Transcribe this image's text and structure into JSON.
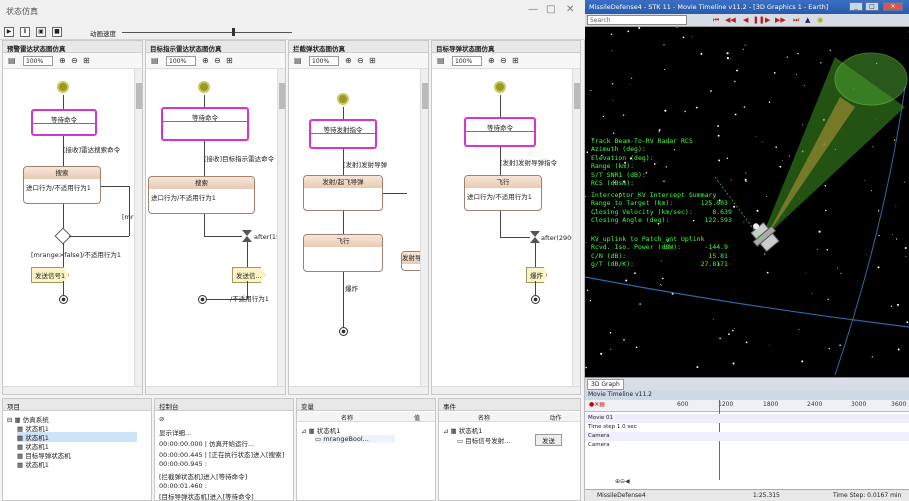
{
  "left_window": {
    "title": "状态仿真",
    "toolbar": {
      "step_label": "动画速度"
    },
    "panes": [
      {
        "title": "预警雷达状态图仿真",
        "zoom": "100%",
        "start_state": "等待命令",
        "trigger1": "[接收]雷达搜索命令",
        "state": {
          "name": "搜索",
          "body": "进口行为/不适用行为1"
        },
        "guard_label": "[mrange>false]/不适用行为1",
        "side_label": "[mrang",
        "send_label": "发送信号1"
      },
      {
        "title": "目标指示雷达状态图仿真",
        "zoom": "100%",
        "start_state": "等待命令",
        "trigger1": "[接收]目标指示雷达命令",
        "state": {
          "name": "搜索",
          "body": "进口行为/不适用行为1"
        },
        "after_label": "after(1500(",
        "send_label": "发送信...",
        "end_label": "/不适用行为1"
      },
      {
        "title": "拦截弹状态图仿真",
        "zoom": "100%",
        "start_state": "等待发射指令",
        "trigger1": "[发射]发射导弹",
        "state": {
          "name": "发射/起飞导弹"
        },
        "side_state": "发射导弹",
        "fly_state": "飞行",
        "end_label": "爆炸"
      },
      {
        "title": "目标导弹状态图仿真",
        "zoom": "100%",
        "start_state": "等待命令",
        "trigger1": "[发射]发射导弹指令",
        "state": {
          "name": "飞行",
          "body": "进口行为/不适用行为1"
        },
        "after_label": "after(2900(",
        "send_label": "爆炸"
      }
    ],
    "bottom": {
      "tree_title": "项目",
      "tree_items": [
        "仿真系统",
        "状态机1",
        "状态机1",
        "状态机1",
        "目标导弹状态机",
        "状态机1"
      ],
      "console_title": "控制台",
      "console_lines": [
        "显示详细...",
        "00:00:00.000 | 仿真开始运行...",
        "00:00:00.445 | [正在执行状态]进入[搜索]",
        "00:00:00.945 :",
        "[拦截弹状态机]进入[等待命令]",
        "00:00:01.460 :",
        "[目标导弹状态机]进入[等待命令]"
      ],
      "vars_title": "变量",
      "vars_cols": [
        "名称",
        "值"
      ],
      "vars_rows": [
        [
          "状态机1",
          ""
        ],
        [
          "mrangeBool...",
          ""
        ]
      ],
      "events_title": "事件",
      "events_cols": [
        "名称",
        "动作"
      ],
      "events_rows": [
        [
          "状态机1",
          ""
        ],
        [
          "目标信号发射...",
          "发送"
        ]
      ]
    }
  },
  "right_window": {
    "title": "MissileDefense4 - STK 11 - Movie Timeline v11.2 - [3D Graphics 1 - Earth]",
    "search_placeholder": "Search",
    "hud_block1": "Track Beam-To-RV Radar RCS\nAzimuth (deg):\nElevation (deg):\nRange (km):\nS/T SNR1 (dB):\nRCS (dBsm):",
    "hud_block2": "Interceptor_KV Intercept Summary\nRange to Target (km):       125.003\nClosing Velocity (km/sec):     8.639\nClosing Angle (deg):         122.593",
    "hud_block3": "KV_uplink to Patch_ant Uplink\nRcvd. Iso. Power (dBW):      -144.9\nC/N (dB):                     15.81\ng/T (dB/K):                 27.8171",
    "view_tab": "3D Graph",
    "timeline_title": "Movie Timeline v11.2",
    "ticks": [
      "600",
      "1200",
      "1800",
      "2400",
      "3000",
      "3600"
    ],
    "tl_rows": [
      "Movie 01",
      "Time step 1.0 sec",
      "Camera",
      "Camera"
    ],
    "status_app": "MissileDefense4",
    "status_time": "1:25.315",
    "status_step": "Time Step: 0.0167 min",
    "colors": {
      "hud": "#3dff3d",
      "state_border": "#d633d6",
      "title_bar": "#2b5aa8"
    }
  }
}
